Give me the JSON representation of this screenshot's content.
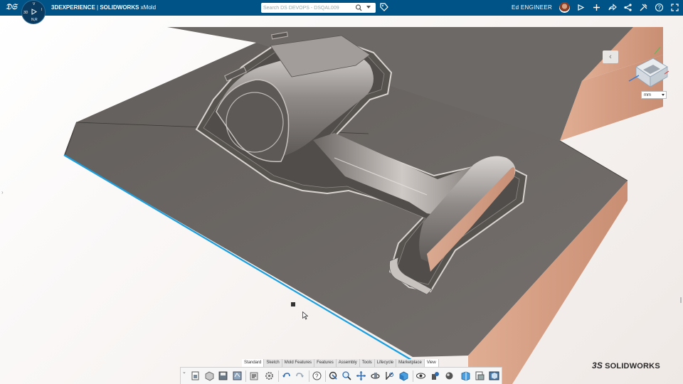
{
  "topbar": {
    "brand_prefix": "3DEXPERIENCE",
    "separator": " | ",
    "brand": "SOLIDWORKS",
    "app": "xMold",
    "search_placeholder": "Search DS DEVOPS - DSQAL009",
    "user_name": "Ed ENGINEER",
    "compass": {
      "v": "V",
      "r": "R",
      "i": "I",
      "three_d": "3D",
      "nr": "N,R"
    },
    "icons": [
      "share-icon",
      "plus-icon",
      "forward-icon",
      "network-icon",
      "tools-icon",
      "help-icon",
      "fullscreen-icon"
    ]
  },
  "viewport": {
    "collapse_glyph": "‹",
    "units": "mm",
    "side_handle_glyph": "›"
  },
  "command_manager": {
    "tabs": [
      {
        "label": "Standard",
        "active": true
      },
      {
        "label": "Sketch",
        "active": false
      },
      {
        "label": "Mold Features",
        "active": false
      },
      {
        "label": "Features",
        "active": false
      },
      {
        "label": "Assembly",
        "active": false
      },
      {
        "label": "Tools",
        "active": false
      },
      {
        "label": "Lifecycle",
        "active": false
      },
      {
        "label": "Marketplace",
        "active": false
      },
      {
        "label": "View",
        "active": false
      }
    ],
    "expand_glyph": "⌄",
    "tools": [
      "new-document-icon",
      "open-part-icon",
      "save-icon",
      "rebuild-icon",
      "file-properties-icon",
      "options-icon",
      "undo-icon",
      "redo-icon",
      "help-icon",
      "select-filter-icon",
      "zoom-icon",
      "pan-icon",
      "rotate-icon",
      "measure-icon",
      "display-style-icon",
      "hide-show-icon",
      "appearance-icon",
      "scene-icon",
      "section-view-icon",
      "view-orientation-icon",
      "render-icon"
    ]
  },
  "logo": {
    "mark": "3S",
    "text": "SOLIDWORKS"
  },
  "colors": {
    "topbar": "#005386",
    "mold_face": "#6e6a67",
    "mold_side": "#d9a58a",
    "highlight_edge": "#1a9fe0"
  }
}
